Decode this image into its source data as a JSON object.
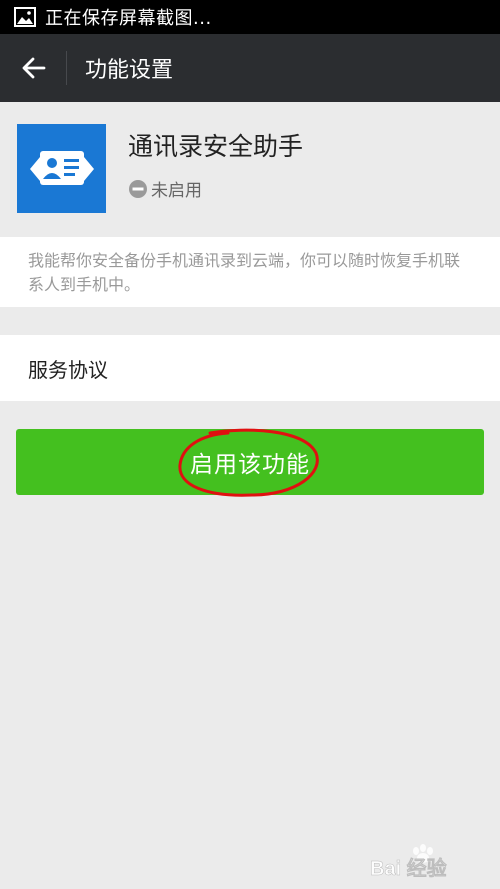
{
  "status_bar": {
    "text": "正在保存屏幕截图...",
    "icon": "image-icon"
  },
  "title_bar": {
    "title": "功能设置",
    "back_icon": "arrow-left-icon"
  },
  "app": {
    "name": "通讯录安全助手",
    "status": "未启用",
    "status_icon": "minus-circle-icon",
    "icon_color": "#1a78d4"
  },
  "description": "我能帮你安全备份手机通讯录到云端，你可以随时恢复手机联系人到手机中。",
  "service_agreement": {
    "label": "服务协议"
  },
  "enable_button": {
    "label": "启用该功能",
    "color": "#44c01f"
  },
  "watermark": {
    "text": "Bai 经验"
  },
  "colors": {
    "title_bar": "#2b2d30",
    "background": "#ebebeb",
    "annotation": "#e01010"
  }
}
